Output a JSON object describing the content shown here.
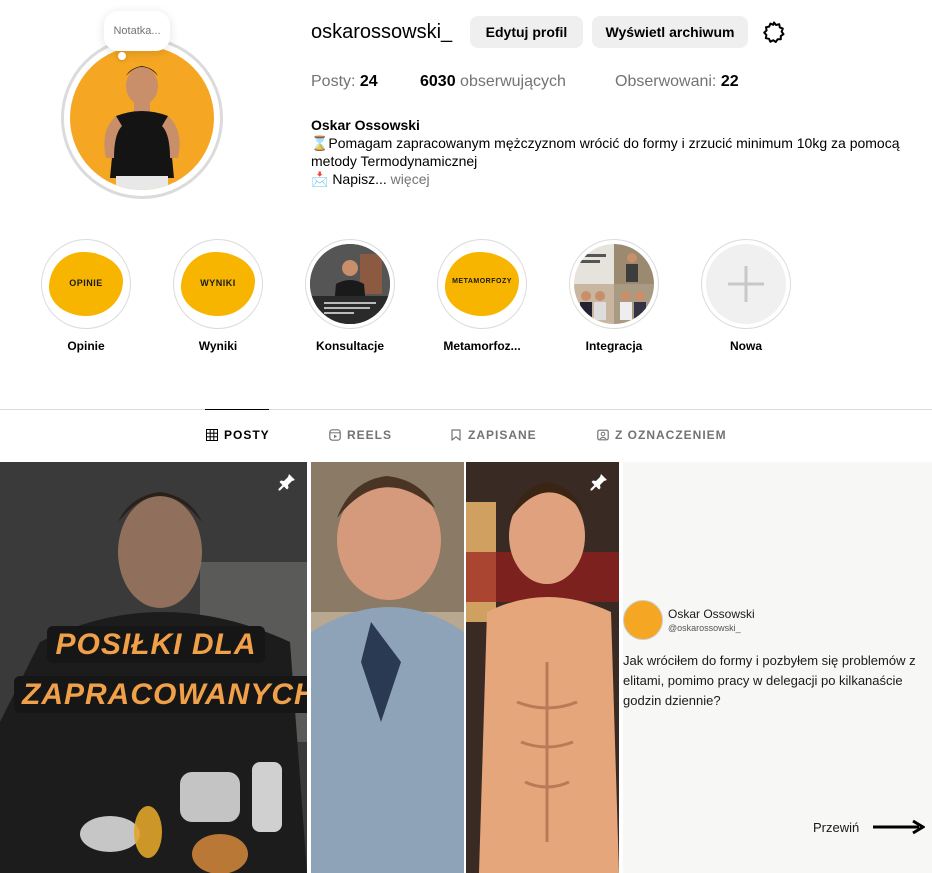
{
  "header": {
    "note": "Notatka...",
    "username": "oskarossowski_",
    "edit_profile": "Edytuj profil",
    "view_archive": "Wyświetl archiwum"
  },
  "stats": {
    "posts_label": "Posty: ",
    "posts_value": "24",
    "followers_value": "6030",
    "followers_label": " obserwujących",
    "following_label": "Obserwowani: ",
    "following_value": "22"
  },
  "bio": {
    "name": "Oskar Ossowski",
    "line1": "⌛Pomagam zapracowanym mężczyznom wrócić do formy i zrzucić minimum 10kg za pomocą metody Termodynamicznej",
    "line2": "📩 Napisz...",
    "more": " więcej"
  },
  "highlights": [
    {
      "label": "Opinie",
      "text": "OPINIE"
    },
    {
      "label": "Wyniki",
      "text": "WYNIKI"
    },
    {
      "label": "Konsultacje",
      "text": ""
    },
    {
      "label": "Metamorfoz...",
      "text": "METAMORFOZY"
    },
    {
      "label": "Integracja",
      "text": ""
    },
    {
      "label": "Nowa",
      "text": ""
    }
  ],
  "tabs": [
    {
      "label": "POSTY",
      "icon": "grid-icon"
    },
    {
      "label": "REELS",
      "icon": "reels-icon"
    },
    {
      "label": "ZAPISANE",
      "icon": "bookmark-icon"
    },
    {
      "label": "Z OZNACZENIEM",
      "icon": "tagged-icon"
    }
  ],
  "posts": {
    "p1_line1": "POSIŁKI DLA",
    "p1_line2": "ZAPRACOWANYCH",
    "p3_name": "Oskar Ossowski",
    "p3_handle": "@oskarossowski_",
    "p3_text": "Jak wróciłem do formy i pozbyłem się problemów z elitami, pomimo pracy w delegacji po kilkanaście godzin dziennie?",
    "p3_more": "Przewiń"
  },
  "colors": {
    "accent_yellow": "#f7b500",
    "text_secondary": "#737373",
    "button_bg": "#efefef"
  }
}
